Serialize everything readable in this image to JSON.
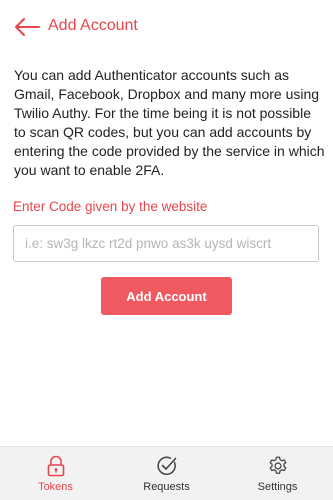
{
  "header": {
    "back_icon": "arrow-left-icon",
    "title": "Add Account"
  },
  "description": "You can add Authenticator accounts such as Gmail, Facebook, Dropbox and many more using Twilio Authy. For the time being it is not possible to scan QR codes, but you can add accounts by entering the code provided by the service in which you want to enable 2FA.",
  "form": {
    "code_label": "Enter Code given by the website",
    "code_value": "",
    "code_placeholder": "i.e: sw3g lkzc rt2d pnwo as3k uysd wiscrt",
    "submit_label": "Add Account"
  },
  "bottom_nav": {
    "items": [
      {
        "label": "Tokens",
        "icon": "lock-icon",
        "active": true
      },
      {
        "label": "Requests",
        "icon": "check-circle-icon",
        "active": false
      },
      {
        "label": "Settings",
        "icon": "gear-icon",
        "active": false
      }
    ]
  },
  "colors": {
    "accent": "#e8464c",
    "button": "#f0595f",
    "nav_background": "#f2f2f2"
  }
}
